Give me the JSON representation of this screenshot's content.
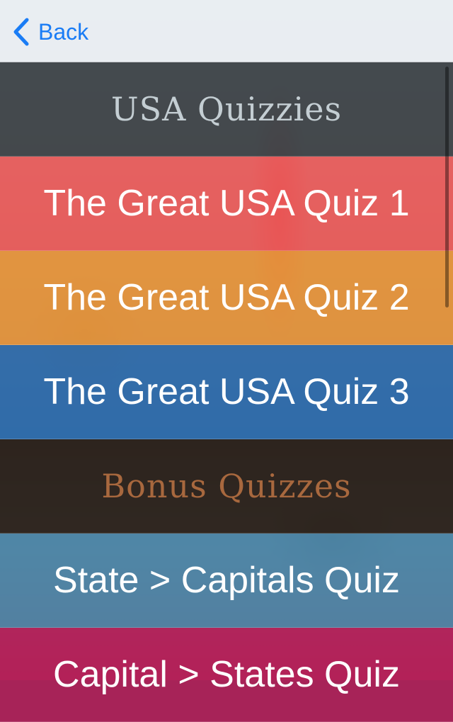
{
  "navbar": {
    "back_label": "Back",
    "back_icon": "chevron-left-icon"
  },
  "sections": [
    {
      "title": "USA Quizzies",
      "header_bg": "#3e4348",
      "header_color": "#c4ced3",
      "items": [
        {
          "label": "The Great USA Quiz 1",
          "bg": "#f25c5c"
        },
        {
          "label": "The Great USA Quiz 2",
          "bg": "#ef9a3c"
        },
        {
          "label": "The Great USA Quiz 3",
          "bg": "#2f6fb3"
        }
      ]
    },
    {
      "title": "Bonus Quizzes",
      "header_bg": "#2c2118",
      "header_color": "#a8683e",
      "items": [
        {
          "label": "State > Capitals Quiz",
          "bg": "#4d88a8"
        },
        {
          "label": "Capital > States Quiz",
          "bg": "#b8205a"
        }
      ]
    }
  ],
  "colors": {
    "accent": "#1a7cf5"
  }
}
